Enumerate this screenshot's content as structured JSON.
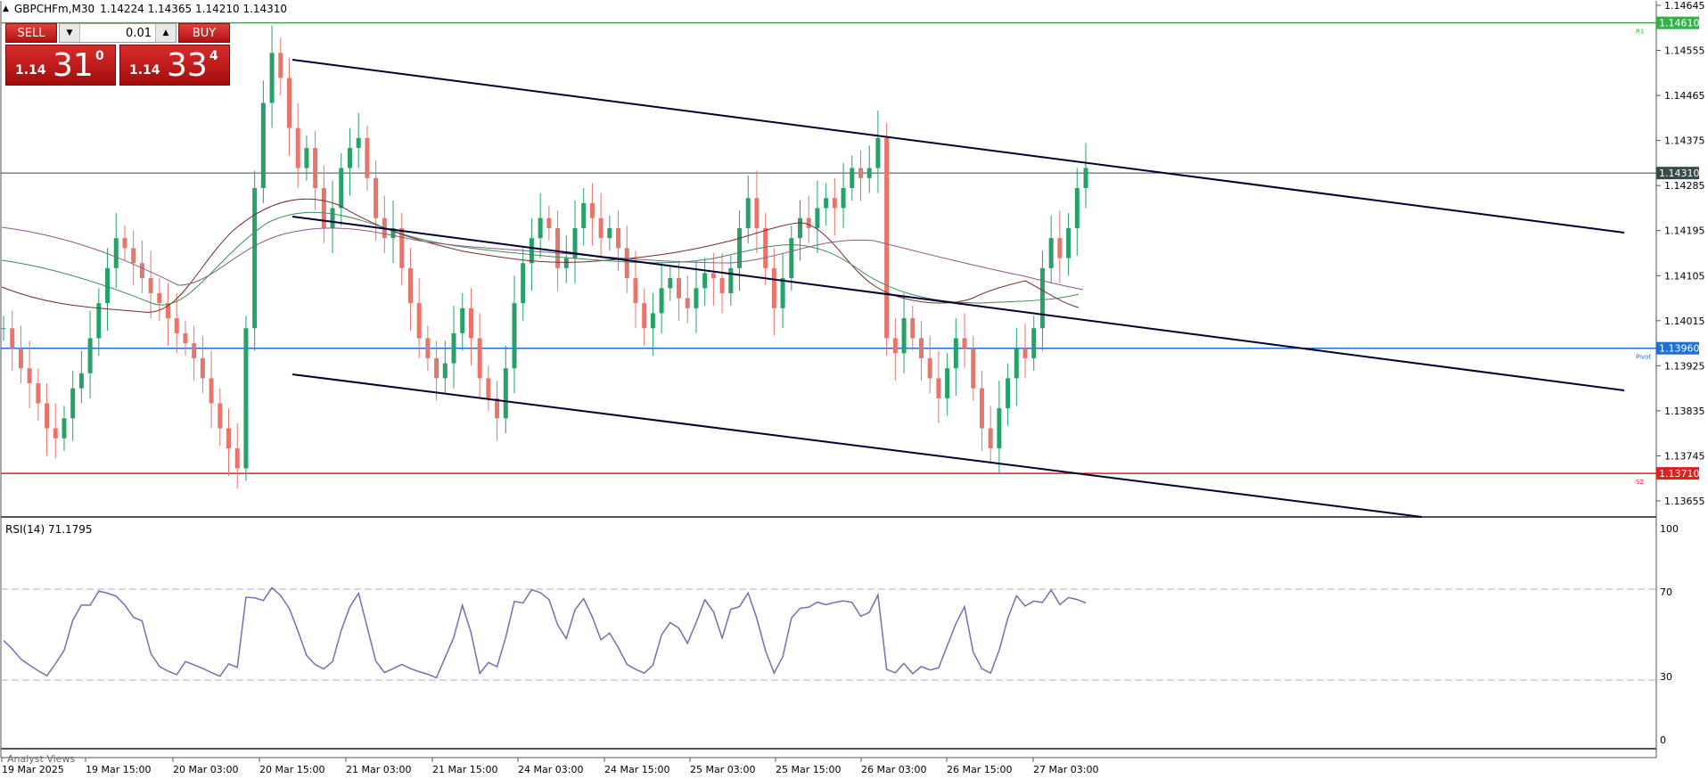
{
  "header": {
    "symbol": "GBPCHFm,M30",
    "ohlc": "1.14224 1.14365 1.14210 1.14310"
  },
  "trade_panel": {
    "sell_label": "SELL",
    "buy_label": "BUY",
    "lot_value": "0.01",
    "sell_price": {
      "prefix": "1.14",
      "big": "31",
      "sup": "0"
    },
    "buy_price": {
      "prefix": "1.14",
      "big": "33",
      "sup": "4"
    }
  },
  "price_axis": {
    "labels": [
      "1.14645",
      "1.14555",
      "1.14465",
      "1.14375",
      "1.14285",
      "1.14195",
      "1.14105",
      "1.14015",
      "1.13925",
      "1.13835",
      "1.13745",
      "1.13655"
    ]
  },
  "levels": [
    {
      "name": "R1",
      "price": 1.1461,
      "label": "1.14610",
      "color": "#33b24a",
      "tag": "R1"
    },
    {
      "name": "current",
      "price": 1.1431,
      "label": "1.14310",
      "color": "#3a4a4a",
      "tag": ""
    },
    {
      "name": "Pivot",
      "price": 1.1396,
      "label": "1.13960",
      "color": "#1e6fd0",
      "tag": "Pivot"
    },
    {
      "name": "S2",
      "price": 1.1371,
      "label": "1.13710",
      "color": "#e02020",
      "tag": "S2"
    }
  ],
  "time_axis": {
    "labels": [
      "19 Mar 2025",
      "19 Mar 15:00",
      "20 Mar 03:00",
      "20 Mar 15:00",
      "21 Mar 03:00",
      "21 Mar 15:00",
      "24 Mar 03:00",
      "24 Mar 15:00",
      "25 Mar 03:00",
      "25 Mar 15:00",
      "26 Mar 03:00",
      "26 Mar 15:00",
      "27 Mar 03:00"
    ]
  },
  "rsi": {
    "label": "RSI(14) 71.1795",
    "levels": [
      "100",
      "70",
      "30",
      "0"
    ]
  },
  "analyst_views_label": "Analyst Views",
  "colors": {
    "bull": "#26a269",
    "bear": "#e8756b",
    "rsi": "#7b6bb5",
    "channel": "#000033"
  },
  "chart_data": {
    "type": "candlestick",
    "series_close": [
      1.14,
      1.1396,
      1.1392,
      1.1389,
      1.1385,
      1.138,
      1.1378,
      1.1382,
      1.1388,
      1.1391,
      1.1398,
      1.1405,
      1.1412,
      1.1418,
      1.1416,
      1.1413,
      1.141,
      1.1407,
      1.1405,
      1.1402,
      1.1399,
      1.1397,
      1.1394,
      1.139,
      1.1385,
      1.138,
      1.1376,
      1.1372,
      1.14,
      1.1428,
      1.1445,
      1.1455,
      1.145,
      1.144,
      1.1432,
      1.1436,
      1.1428,
      1.142,
      1.1424,
      1.1432,
      1.1436,
      1.1438,
      1.143,
      1.1422,
      1.1418,
      1.142,
      1.1412,
      1.1405,
      1.1398,
      1.1394,
      1.139,
      1.1393,
      1.1399,
      1.1404,
      1.1398,
      1.139,
      1.1386,
      1.1382,
      1.1392,
      1.1405,
      1.1413,
      1.1418,
      1.1422,
      1.142,
      1.1412,
      1.1414,
      1.142,
      1.1425,
      1.1422,
      1.1418,
      1.142,
      1.1416,
      1.141,
      1.1405,
      1.14,
      1.1403,
      1.1408,
      1.141,
      1.1406,
      1.1404,
      1.1408,
      1.1411,
      1.141,
      1.1407,
      1.1412,
      1.142,
      1.1426,
      1.142,
      1.1412,
      1.1404,
      1.141,
      1.1418,
      1.1422,
      1.142,
      1.1424,
      1.1426,
      1.1424,
      1.1428,
      1.1432,
      1.143,
      1.1432,
      1.1438,
      1.1398,
      1.1395,
      1.1402,
      1.1398,
      1.1394,
      1.139,
      1.1386,
      1.1392,
      1.1398,
      1.1396,
      1.1388,
      1.138,
      1.1376,
      1.1384,
      1.139,
      1.1396,
      1.1394,
      1.14,
      1.1412,
      1.1418,
      1.1414,
      1.142,
      1.1428,
      1.1432
    ]
  }
}
